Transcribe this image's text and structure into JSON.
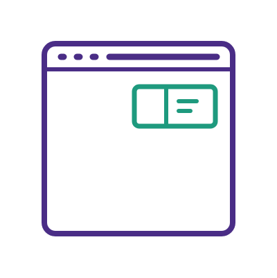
{
  "illustration": {
    "icon_name": "browser-window-with-card-widget-icon",
    "colors": {
      "window_stroke": "#4a2d86",
      "widget_stroke": "#1e9a7e",
      "background": "#ffffff"
    }
  },
  "window": {
    "control_dots": [
      "dot",
      "dot",
      "dot"
    ],
    "address_bar_present": true
  },
  "widget": {
    "position_hint": "top-right",
    "text_lines": 2
  }
}
